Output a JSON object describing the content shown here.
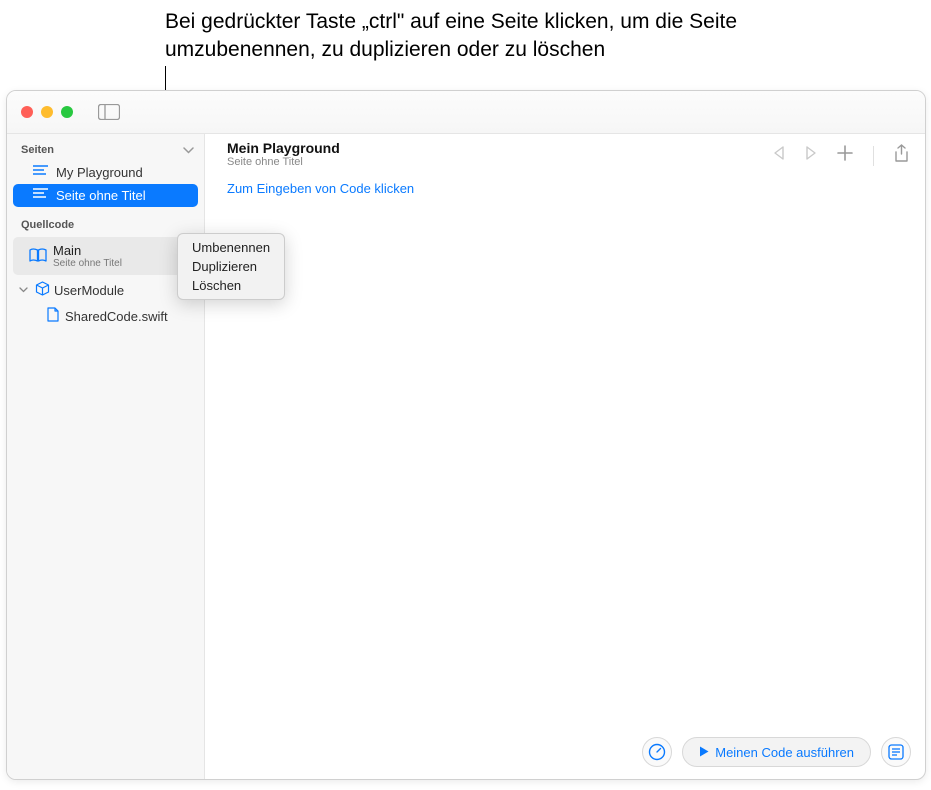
{
  "callout": "Bei gedrückter Taste „ctrl\" auf eine Seite klicken, um die Seite umzubenennen, zu duplizieren oder zu löschen",
  "sidebar": {
    "sections": {
      "pages_title": "Seiten",
      "sources_title": "Quellcode"
    },
    "pages": [
      {
        "label": "My Playground"
      },
      {
        "label": "Seite ohne Titel"
      }
    ],
    "main_module": {
      "title": "Main",
      "subtitle": "Seite ohne Titel"
    },
    "user_module": {
      "label": "UserModule",
      "files": [
        {
          "label": "SharedCode.swift"
        }
      ]
    }
  },
  "header": {
    "title": "Mein Playground",
    "subtitle": "Seite ohne Titel"
  },
  "editor": {
    "placeholder": "Zum Eingeben von Code klicken"
  },
  "context_menu": {
    "items": [
      "Umbenennen",
      "Duplizieren",
      "Löschen"
    ]
  },
  "footer": {
    "run_label": "Meinen Code ausführen"
  }
}
